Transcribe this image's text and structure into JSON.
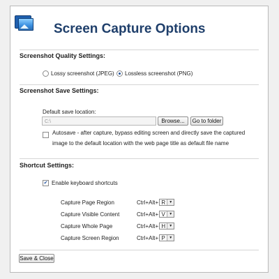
{
  "header": {
    "title": "Screen Capture Options",
    "icon": "screen-capture-app-icon"
  },
  "quality": {
    "heading": "Screenshot Quality Settings:",
    "options": [
      {
        "label": "Lossy screenshot (JPEG)",
        "selected": false
      },
      {
        "label": "Lossless screenshot (PNG)",
        "selected": true
      }
    ]
  },
  "save": {
    "heading": "Screenshot Save Settings:",
    "location_label": "Default save location:",
    "location_value": "C:\\",
    "browse_label": "Browse...",
    "goto_label": "Go to folder",
    "autosave_checked": false,
    "autosave_line1": "Autosave - after capture, bypass editing screen and directly save the captured",
    "autosave_line2": "image to the default location with the web page title as default file name"
  },
  "shortcuts": {
    "heading": "Shortcut Settings:",
    "enable_label": "Enable keyboard shortcuts",
    "enable_checked": true,
    "prefix": "Ctrl+Alt+",
    "items": [
      {
        "label": "Capture Page Region",
        "key": "R"
      },
      {
        "label": "Capture Visible Content",
        "key": "V"
      },
      {
        "label": "Capture Whole Page",
        "key": "H"
      },
      {
        "label": "Capture Screen Region",
        "key": "P"
      }
    ]
  },
  "footer": {
    "save_close_label": "Save & Close"
  }
}
